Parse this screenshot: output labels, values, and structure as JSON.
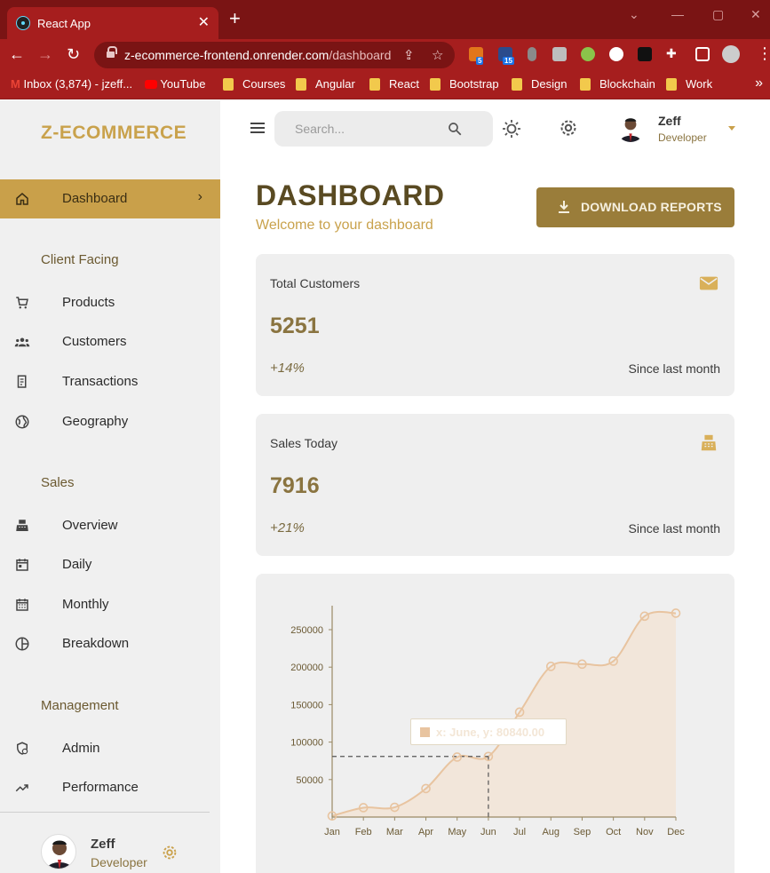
{
  "browser": {
    "tab_title": "React App",
    "url_host": "z-ecommerce-frontend.onrender.com",
    "url_path": "/dashboard",
    "extension_badges": [
      "5",
      "15"
    ],
    "bookmarks": [
      "Inbox (3,874) - jzeff...",
      "YouTube",
      "Courses",
      "Angular",
      "React",
      "Bootstrap",
      "Design",
      "Blockchain",
      "Work"
    ]
  },
  "sidebar": {
    "brand": "Z-ECOMMERCE",
    "active_item": "Dashboard",
    "sections": {
      "client": "Client Facing",
      "sales": "Sales",
      "management": "Management"
    },
    "items": {
      "dashboard": "Dashboard",
      "products": "Products",
      "customers": "Customers",
      "transactions": "Transactions",
      "geography": "Geography",
      "overview": "Overview",
      "daily": "Daily",
      "monthly": "Monthly",
      "breakdown": "Breakdown",
      "admin": "Admin",
      "performance": "Performance"
    },
    "user": {
      "name": "Zeff",
      "role": "Developer"
    }
  },
  "topbar": {
    "search_placeholder": "Search...",
    "user": {
      "name": "Zeff",
      "role": "Developer"
    }
  },
  "header": {
    "title": "DASHBOARD",
    "subtitle": "Welcome to your dashboard",
    "download_label": "DOWNLOAD REPORTS"
  },
  "stats": {
    "customers": {
      "title": "Total Customers",
      "value": "5251",
      "change": "+14%",
      "since": "Since last month"
    },
    "sales": {
      "title": "Sales Today",
      "value": "7916",
      "change": "+21%",
      "since": "Since last month"
    }
  },
  "colors": {
    "brand": "#c9a24c",
    "active_nav": "#c9a04a",
    "button": "#9a7d3a",
    "chart_line": "#e8c4a0"
  },
  "chart_data": {
    "type": "area",
    "x": [
      "Jan",
      "Feb",
      "Mar",
      "Apr",
      "May",
      "Jun",
      "Jul",
      "Aug",
      "Sep",
      "Oct",
      "Nov",
      "Dec"
    ],
    "values": [
      1500,
      12500,
      13000,
      38000,
      80000,
      80840,
      140000,
      201000,
      204000,
      208000,
      268000,
      272000
    ],
    "yticks": [
      50000,
      100000,
      150000,
      200000,
      250000
    ],
    "ylim": [
      0,
      282000
    ],
    "grid": false,
    "tooltip": "x: June, y: 80840.00",
    "highlight_index": 5
  }
}
